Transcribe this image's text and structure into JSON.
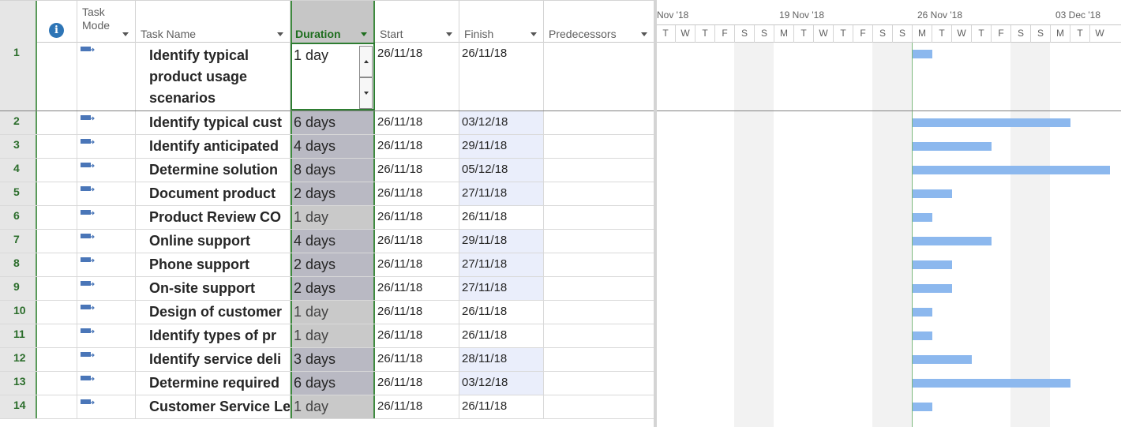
{
  "columns": {
    "info_icon": "i",
    "task_mode_line1": "Task",
    "task_mode_line2": "Mode",
    "task_name": "Task Name",
    "duration": "Duration",
    "start": "Start",
    "finish": "Finish",
    "predecessors": "Predecessors"
  },
  "timescale": {
    "weeks": [
      "Nov '18",
      "19 Nov '18",
      "26 Nov '18",
      "03 Dec '18"
    ],
    "day_letters": [
      "T",
      "W",
      "T",
      "F",
      "S",
      "S",
      "M",
      "T",
      "W",
      "T",
      "F",
      "S",
      "S",
      "M",
      "T",
      "W",
      "T",
      "F",
      "S",
      "S",
      "M",
      "T",
      "W"
    ]
  },
  "colors": {
    "bar": "#8cb8ee",
    "id_text": "#2b6d2b",
    "info_icon": "#2e75b6"
  },
  "tasks": [
    {
      "id": "1",
      "mode": "auto-schedule-icon",
      "name": "Identify typical product usage scenarios",
      "duration": "1 day",
      "start": "26/11/18",
      "finish": "26/11/18",
      "days": 1
    },
    {
      "id": "2",
      "mode": "auto-schedule-icon",
      "name": "Identify typical cust",
      "duration": "6 days",
      "start": "26/11/18",
      "finish": "03/12/18",
      "days": 6
    },
    {
      "id": "3",
      "mode": "auto-schedule-icon",
      "name": "Identify anticipated",
      "duration": "4 days",
      "start": "26/11/18",
      "finish": "29/11/18",
      "days": 4
    },
    {
      "id": "4",
      "mode": "auto-schedule-icon",
      "name": "Determine solution",
      "duration": "8 days",
      "start": "26/11/18",
      "finish": "05/12/18",
      "days": 8
    },
    {
      "id": "5",
      "mode": "auto-schedule-icon",
      "name": "Document product",
      "duration": "2 days",
      "start": "26/11/18",
      "finish": "27/11/18",
      "days": 2
    },
    {
      "id": "6",
      "mode": "auto-schedule-icon",
      "name": "Product Review CO",
      "duration": "1 day",
      "start": "26/11/18",
      "finish": "26/11/18",
      "days": 1
    },
    {
      "id": "7",
      "mode": "auto-schedule-icon",
      "name": "Online support",
      "duration": "4 days",
      "start": "26/11/18",
      "finish": "29/11/18",
      "days": 4
    },
    {
      "id": "8",
      "mode": "auto-schedule-icon",
      "name": "Phone support",
      "duration": "2 days",
      "start": "26/11/18",
      "finish": "27/11/18",
      "days": 2
    },
    {
      "id": "9",
      "mode": "auto-schedule-icon",
      "name": "On-site support",
      "duration": "2 days",
      "start": "26/11/18",
      "finish": "27/11/18",
      "days": 2
    },
    {
      "id": "10",
      "mode": "auto-schedule-icon",
      "name": "Design of customer",
      "duration": "1 day",
      "start": "26/11/18",
      "finish": "26/11/18",
      "days": 1
    },
    {
      "id": "11",
      "mode": "auto-schedule-icon",
      "name": "Identify types of pr",
      "duration": "1 day",
      "start": "26/11/18",
      "finish": "26/11/18",
      "days": 1
    },
    {
      "id": "12",
      "mode": "auto-schedule-icon",
      "name": "Identify service deli",
      "duration": "3 days",
      "start": "26/11/18",
      "finish": "28/11/18",
      "days": 3
    },
    {
      "id": "13",
      "mode": "auto-schedule-icon",
      "name": "Determine required",
      "duration": "6 days",
      "start": "26/11/18",
      "finish": "03/12/18",
      "days": 6
    },
    {
      "id": "14",
      "mode": "auto-schedule-icon",
      "name": "Customer Service Le",
      "duration": "1 day",
      "start": "26/11/18",
      "finish": "26/11/18",
      "days": 1
    }
  ]
}
